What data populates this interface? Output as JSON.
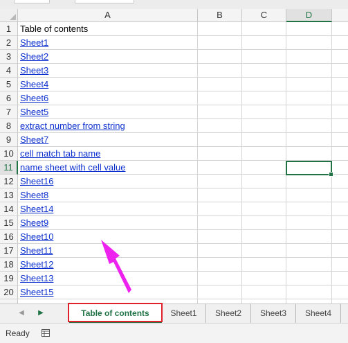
{
  "columns": [
    {
      "label": "A",
      "selected": false
    },
    {
      "label": "B",
      "selected": false
    },
    {
      "label": "C",
      "selected": false
    },
    {
      "label": "D",
      "selected": true
    }
  ],
  "rows": [
    {
      "num": "1",
      "text": "Table of contents",
      "link": false
    },
    {
      "num": "2",
      "text": "Sheet1",
      "link": true
    },
    {
      "num": "3",
      "text": "Sheet2",
      "link": true
    },
    {
      "num": "4",
      "text": "Sheet3",
      "link": true
    },
    {
      "num": "5",
      "text": "Sheet4",
      "link": true
    },
    {
      "num": "6",
      "text": "Sheet6",
      "link": true
    },
    {
      "num": "7",
      "text": "Sheet5",
      "link": true
    },
    {
      "num": "8",
      "text": "extract number from string",
      "link": true
    },
    {
      "num": "9",
      "text": "Sheet7",
      "link": true
    },
    {
      "num": "10",
      "text": "cell match tab name",
      "link": true
    },
    {
      "num": "11",
      "text": "name sheet with cell value",
      "link": true,
      "selected": true
    },
    {
      "num": "12",
      "text": "Sheet16",
      "link": true
    },
    {
      "num": "13",
      "text": "Sheet8",
      "link": true
    },
    {
      "num": "14",
      "text": "Sheet14",
      "link": true
    },
    {
      "num": "15",
      "text": "Sheet9",
      "link": true
    },
    {
      "num": "16",
      "text": "Sheet10",
      "link": true
    },
    {
      "num": "17",
      "text": "Sheet11",
      "link": true
    },
    {
      "num": "18",
      "text": "Sheet12",
      "link": true
    },
    {
      "num": "19",
      "text": "Sheet13",
      "link": true
    },
    {
      "num": "20",
      "text": "Sheet15",
      "link": true
    }
  ],
  "sheet_tabs": [
    {
      "label": "Table of contents",
      "active": true
    },
    {
      "label": "Sheet1",
      "active": false
    },
    {
      "label": "Sheet2",
      "active": false
    },
    {
      "label": "Sheet3",
      "active": false
    },
    {
      "label": "Sheet4",
      "active": false
    }
  ],
  "status": {
    "text": "Ready"
  },
  "colors": {
    "accent": "#217346",
    "link": "#0b2fcf",
    "highlight": "#e0202a",
    "arrow": "#ee22ee"
  },
  "icons": {
    "nav_prev": "triangle-left-icon",
    "nav_next": "triangle-right-icon",
    "macro": "macro-record-icon"
  }
}
